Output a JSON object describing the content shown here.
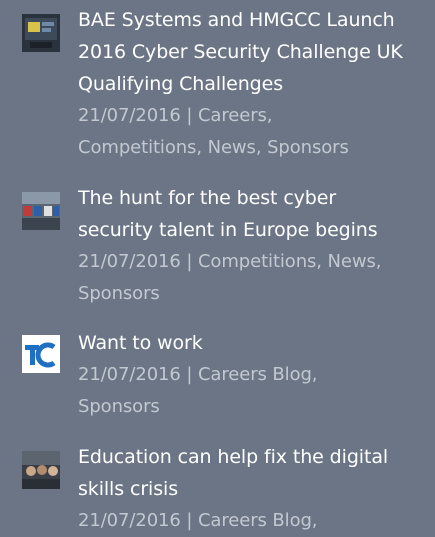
{
  "posts": [
    {
      "title_lines": [
        "BAE Systems and HMGCC Launch",
        "2016 Cyber Security Challenge UK",
        "Qualifying Challenges"
      ],
      "date": "21/07/2016",
      "separator": "|",
      "categories": [
        "Careers,",
        "Competitions,",
        "News,",
        "Sponsors"
      ],
      "thumb_icon": "bae-hmgcc-thumbnail"
    },
    {
      "title_lines": [
        "The hunt for the best cyber",
        "security talent in Europe begins"
      ],
      "date": "21/07/2016",
      "separator": "|",
      "categories": [
        "Competitions,",
        "News,",
        "Sponsors"
      ],
      "thumb_icon": "europe-challenge-thumbnail"
    },
    {
      "title_lines": [
        "Want to work"
      ],
      "date": "21/07/2016",
      "separator": "|",
      "categories": [
        "Careers Blog,",
        "Sponsors"
      ],
      "thumb_icon": "tc-logo-thumbnail"
    },
    {
      "title_lines": [
        "Education can help fix the digital",
        "skills crisis"
      ],
      "date": "21/07/2016",
      "separator": "|",
      "categories": [
        "Careers Blog,"
      ],
      "thumb_icon": "classroom-thumbnail"
    }
  ],
  "colors": {
    "background": "#6b7585",
    "title": "#ffffff",
    "meta": "#c3c8d1"
  }
}
